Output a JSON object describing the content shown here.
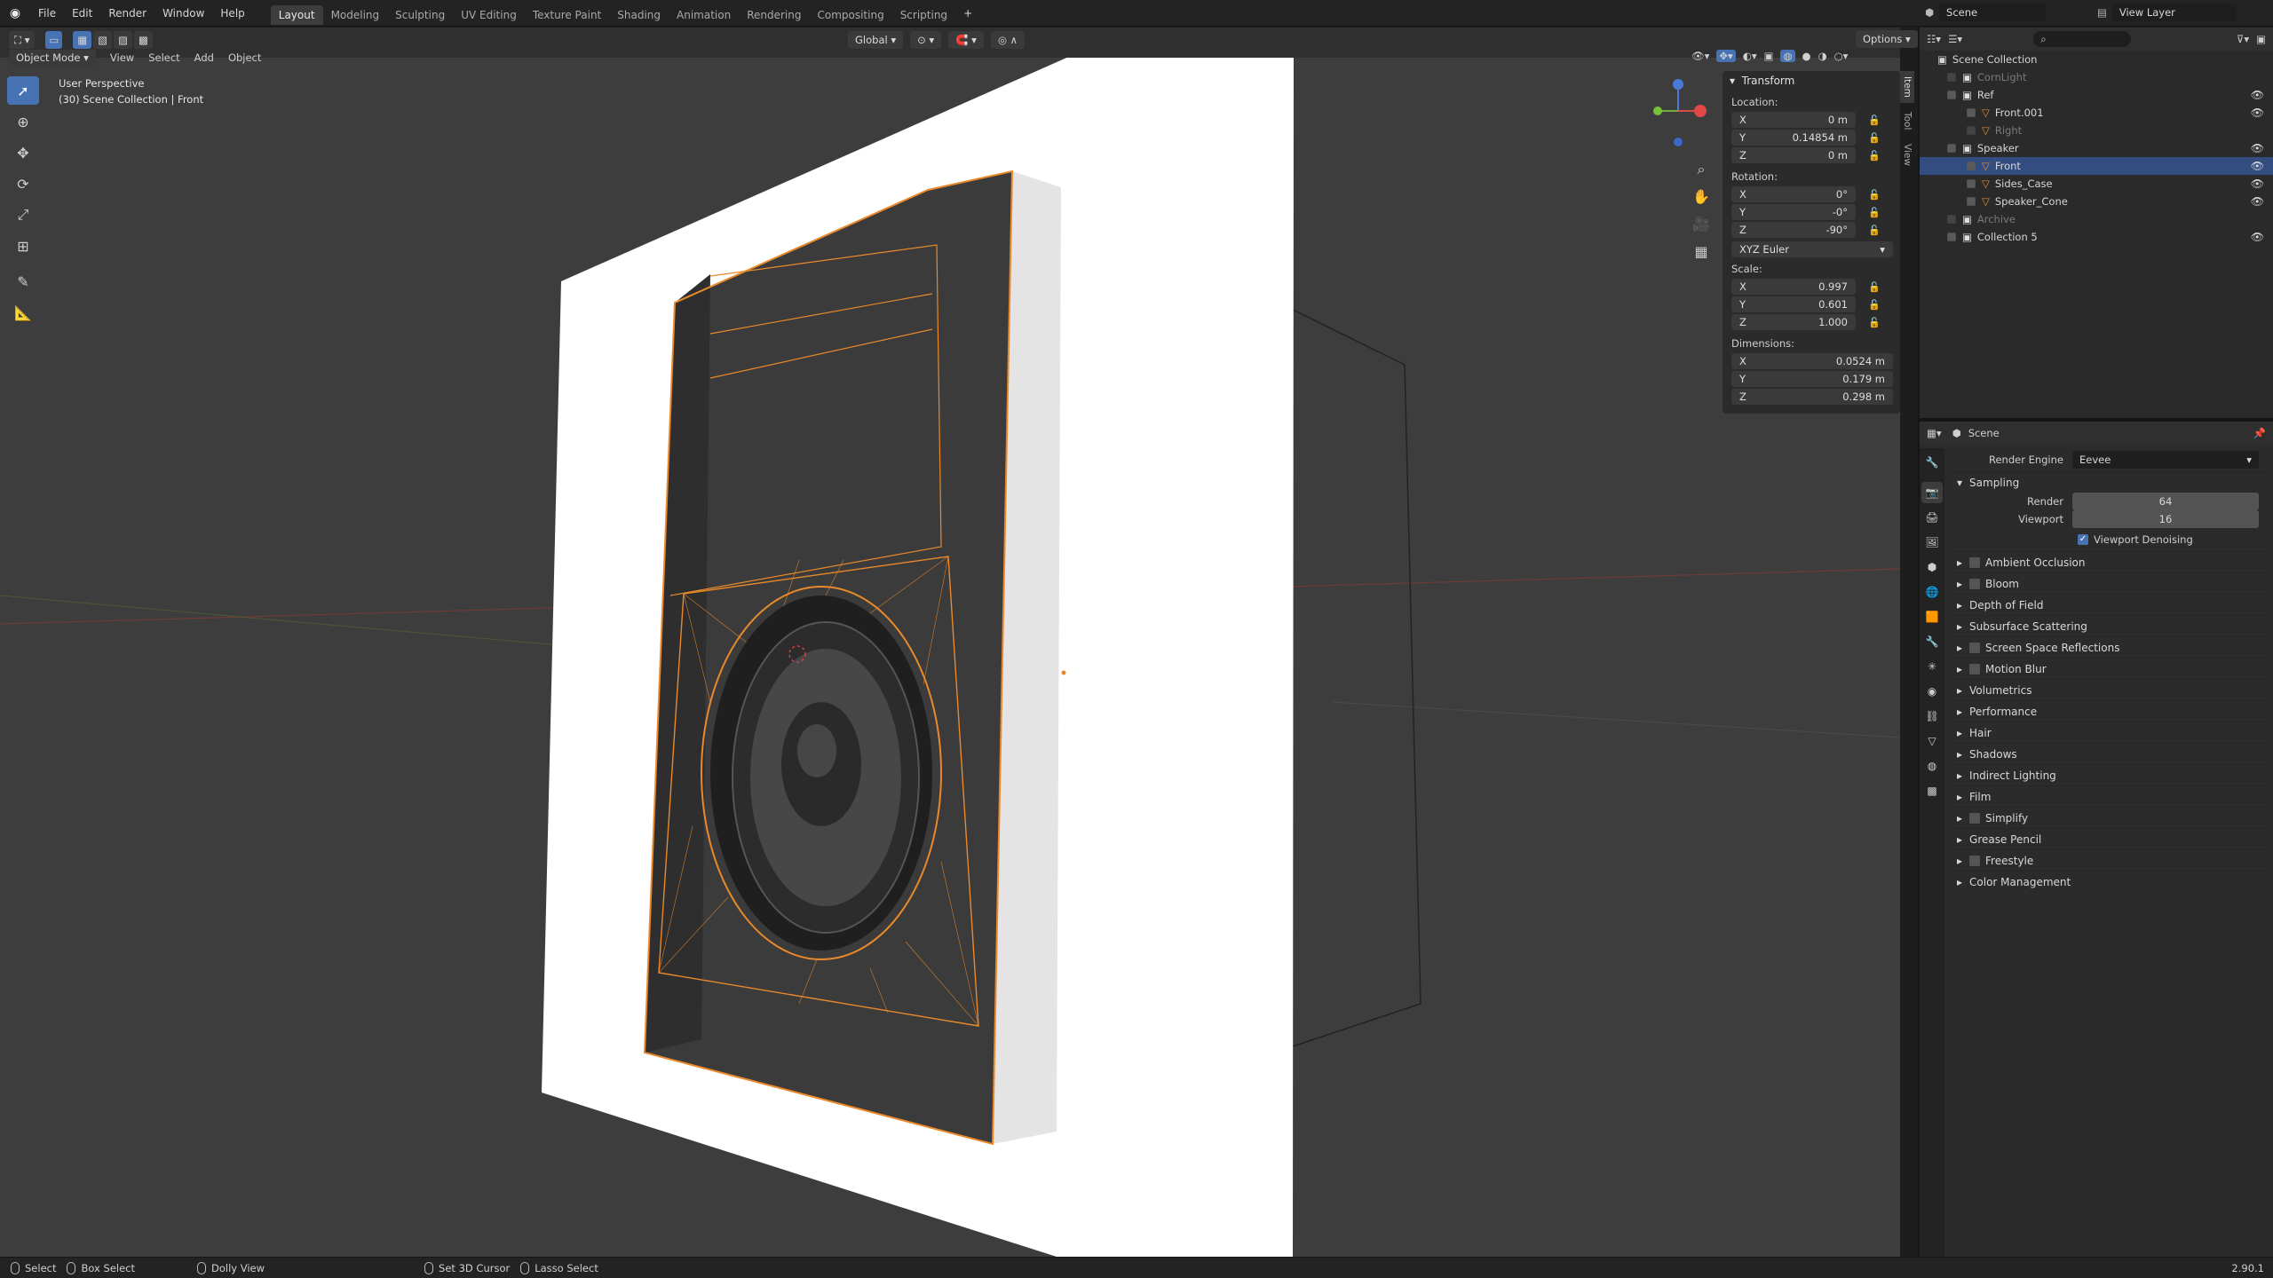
{
  "app": {
    "version": "2.90.1"
  },
  "menu": [
    "File",
    "Edit",
    "Render",
    "Window",
    "Help"
  ],
  "workspaces": [
    {
      "label": "Layout",
      "active": true
    },
    {
      "label": "Modeling"
    },
    {
      "label": "Sculpting"
    },
    {
      "label": "UV Editing"
    },
    {
      "label": "Texture Paint"
    },
    {
      "label": "Shading"
    },
    {
      "label": "Animation"
    },
    {
      "label": "Rendering"
    },
    {
      "label": "Compositing"
    },
    {
      "label": "Scripting"
    }
  ],
  "topbar": {
    "scene": "Scene",
    "view_layer": "View Layer",
    "add_workspace": "+"
  },
  "tool_header": {
    "orientation": "Global",
    "options": "Options"
  },
  "viewport_header": {
    "mode": "Object Mode",
    "menus": [
      "View",
      "Select",
      "Add",
      "Object"
    ]
  },
  "viewport": {
    "perspective": "User Perspective",
    "context": "(30) Scene Collection | Front"
  },
  "npanel": {
    "tabs": [
      "Item",
      "Tool",
      "View"
    ],
    "section": "Transform",
    "location_label": "Location:",
    "location": [
      {
        "axis": "X",
        "value": "0 m"
      },
      {
        "axis": "Y",
        "value": "0.14854 m"
      },
      {
        "axis": "Z",
        "value": "0 m"
      }
    ],
    "rotation_label": "Rotation:",
    "rotation": [
      {
        "axis": "X",
        "value": "0°"
      },
      {
        "axis": "Y",
        "value": "-0°"
      },
      {
        "axis": "Z",
        "value": "-90°"
      }
    ],
    "rotation_mode": "XYZ Euler",
    "scale_label": "Scale:",
    "scale": [
      {
        "axis": "X",
        "value": "0.997"
      },
      {
        "axis": "Y",
        "value": "0.601"
      },
      {
        "axis": "Z",
        "value": "1.000"
      }
    ],
    "dimensions_label": "Dimensions:",
    "dimensions": [
      {
        "axis": "X",
        "value": "0.0524 m"
      },
      {
        "axis": "Y",
        "value": "0.179 m"
      },
      {
        "axis": "Z",
        "value": "0.298 m"
      }
    ]
  },
  "outliner": {
    "root": "Scene Collection",
    "items": [
      {
        "label": "CornLight",
        "indent": 1,
        "dim": true
      },
      {
        "label": "Ref",
        "indent": 1
      },
      {
        "label": "Front.001",
        "indent": 2
      },
      {
        "label": "Right",
        "indent": 2,
        "dim": true
      },
      {
        "label": "Speaker",
        "indent": 1
      },
      {
        "label": "Front",
        "indent": 2,
        "selected": true
      },
      {
        "label": "Sides_Case",
        "indent": 2
      },
      {
        "label": "Speaker_Cone",
        "indent": 2
      },
      {
        "label": "Archive",
        "indent": 1,
        "dim": true
      },
      {
        "label": "Collection 5",
        "indent": 1
      }
    ]
  },
  "properties": {
    "context": "Scene",
    "render_engine_label": "Render Engine",
    "render_engine": "Eevee",
    "sampling": {
      "title": "Sampling",
      "render_label": "Render",
      "render": "64",
      "viewport_label": "Viewport",
      "viewport": "16",
      "denoise": "Viewport Denoising"
    },
    "sections": [
      {
        "label": "Ambient Occlusion",
        "checkbox": true
      },
      {
        "label": "Bloom",
        "checkbox": true
      },
      {
        "label": "Depth of Field"
      },
      {
        "label": "Subsurface Scattering"
      },
      {
        "label": "Screen Space Reflections",
        "checkbox": true
      },
      {
        "label": "Motion Blur",
        "checkbox": true
      },
      {
        "label": "Volumetrics"
      },
      {
        "label": "Performance"
      },
      {
        "label": "Hair"
      },
      {
        "label": "Shadows"
      },
      {
        "label": "Indirect Lighting"
      },
      {
        "label": "Film"
      },
      {
        "label": "Simplify",
        "checkbox": true
      },
      {
        "label": "Grease Pencil"
      },
      {
        "label": "Freestyle",
        "checkbox": true
      },
      {
        "label": "Color Management"
      }
    ]
  },
  "statusbar": {
    "select": "Select",
    "box_select": "Box Select",
    "dolly": "Dolly View",
    "cursor": "Set 3D Cursor",
    "lasso": "Lasso Select"
  },
  "colors": {
    "accent": "#4772b3",
    "selection": "#e8892b",
    "viewport_bg": "#3d3d3d"
  }
}
